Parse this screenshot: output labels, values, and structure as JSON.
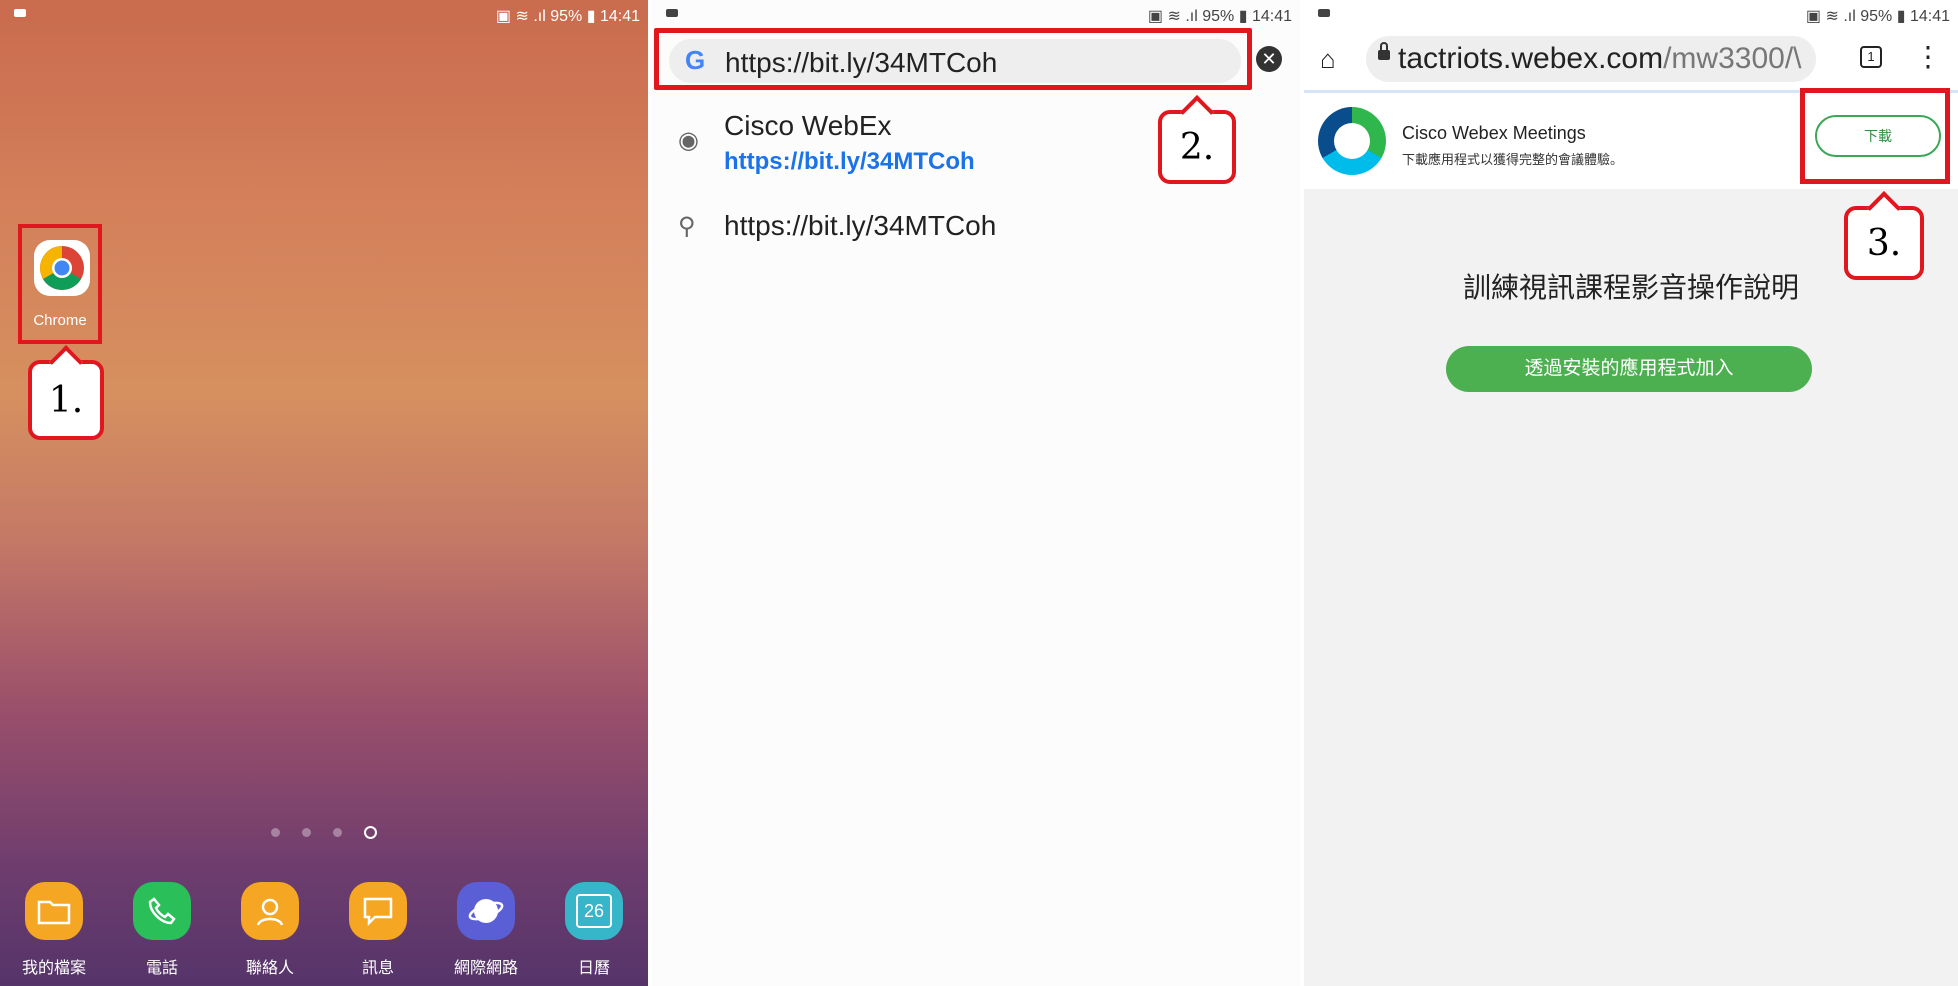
{
  "status": {
    "battery": "95%",
    "time": "14:41"
  },
  "panel1": {
    "chrome_label": "Chrome",
    "step_label": "1.",
    "dock": [
      {
        "label": "我的檔案",
        "color": "#f5a623",
        "icon": "folder-icon"
      },
      {
        "label": "電話",
        "color": "#2bbf5a",
        "icon": "phone-icon"
      },
      {
        "label": "聯絡人",
        "color": "#f5a623",
        "icon": "contacts-icon"
      },
      {
        "label": "訊息",
        "color": "#f5a623",
        "icon": "messages-icon"
      },
      {
        "label": "網際網路",
        "color": "#5b5fd6",
        "icon": "internet-icon"
      },
      {
        "label": "日曆",
        "color": "#37b6c9",
        "icon": "calendar-icon",
        "day": "26"
      }
    ]
  },
  "panel2": {
    "url": "https://bit.ly/34MTCoh",
    "step_label": "2.",
    "suggestions": [
      {
        "title": "Cisco WebEx",
        "sub": "https://bit.ly/34MTCoh",
        "icon": "globe-icon"
      },
      {
        "title": "https://bit.ly/34MTCoh",
        "icon": "search-icon"
      }
    ]
  },
  "panel3": {
    "address_main": "tactriots.webex.com",
    "address_path": "/mw3300/\\",
    "tab_count": "1",
    "banner_title": "Cisco Webex Meetings",
    "banner_sub": "下載應用程式以獲得完整的會議體驗。",
    "download_label": "下載",
    "step_label": "3.",
    "page_title": "訓練視訊課程影音操作說明",
    "join_label": "透過安裝的應用程式加入"
  }
}
